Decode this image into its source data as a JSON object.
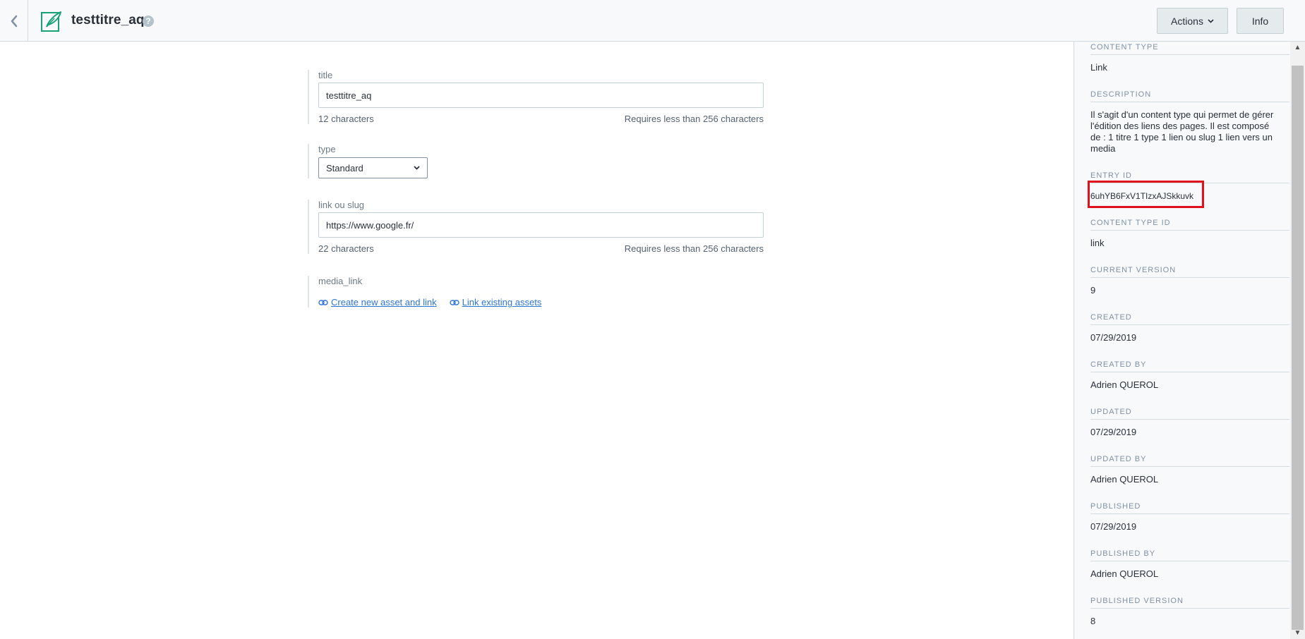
{
  "header": {
    "back_icon": "chevron-left-icon",
    "entry_icon": "feather-pen-icon",
    "title": "testtitre_aq",
    "help_icon": "question-mark-icon",
    "actions_label": "Actions",
    "info_label": "Info",
    "accent_color": "#19a177"
  },
  "fields": {
    "title": {
      "label": "title",
      "value": "testtitre_aq",
      "count": "12 characters",
      "limit": "Requires less than 256 characters"
    },
    "type": {
      "label": "type",
      "selected": "Standard"
    },
    "link": {
      "label": "link ou slug",
      "value": "https://www.google.fr/",
      "count": "22 characters",
      "limit": "Requires less than 256 characters"
    },
    "media": {
      "label": "media_link",
      "create_label": "Create new asset and link",
      "link_existing_label": "Link existing assets"
    }
  },
  "sidebar": {
    "content_type": {
      "heading": "CONTENT TYPE",
      "value": "Link"
    },
    "description": {
      "heading": "DESCRIPTION",
      "value": "Il s'agit d'un content type qui permet de gérer l'édition des liens des pages. Il est composé de : 1 titre 1 type 1 lien ou slug 1 lien vers un media"
    },
    "entry_id": {
      "heading": "ENTRY ID",
      "value": "6uhYB6FxV1TIzxAJSkkuvk"
    },
    "content_type_id": {
      "heading": "CONTENT TYPE ID",
      "value": "link"
    },
    "current_version": {
      "heading": "CURRENT VERSION",
      "value": "9"
    },
    "created": {
      "heading": "CREATED",
      "value": "07/29/2019"
    },
    "created_by": {
      "heading": "CREATED BY",
      "value": "Adrien QUEROL"
    },
    "updated": {
      "heading": "UPDATED",
      "value": "07/29/2019"
    },
    "updated_by": {
      "heading": "UPDATED BY",
      "value": "Adrien QUEROL"
    },
    "published": {
      "heading": "PUBLISHED",
      "value": "07/29/2019"
    },
    "published_by": {
      "heading": "PUBLISHED BY",
      "value": "Adrien QUEROL"
    },
    "published_version": {
      "heading": "PUBLISHED VERSION",
      "value": "8"
    }
  }
}
